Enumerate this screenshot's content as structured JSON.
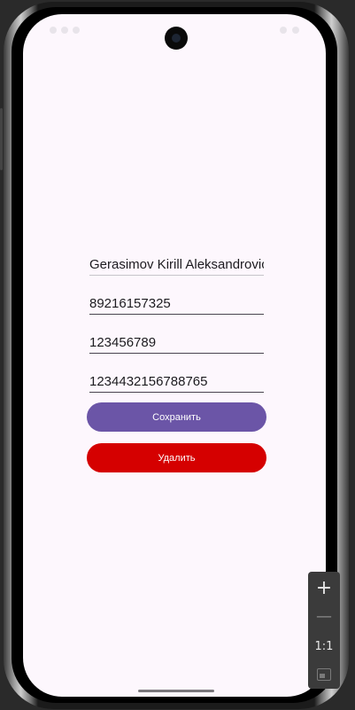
{
  "form": {
    "name_value": "Gerasimov Kirill Aleksandrovic",
    "phone_value": "89216157325",
    "field3_value": "123456789",
    "field4_value": "1234432156788765"
  },
  "buttons": {
    "save_label": "Сохранить",
    "delete_label": "Удалить"
  },
  "zoom_controls": {
    "zoom_in_label": "+",
    "zoom_out_label": "—",
    "reset_label": "1:1",
    "fit_icon": "fit-screen-icon"
  },
  "colors": {
    "background": "#fdf7fd",
    "save_button": "#6b55a7",
    "delete_button": "#d50000"
  }
}
